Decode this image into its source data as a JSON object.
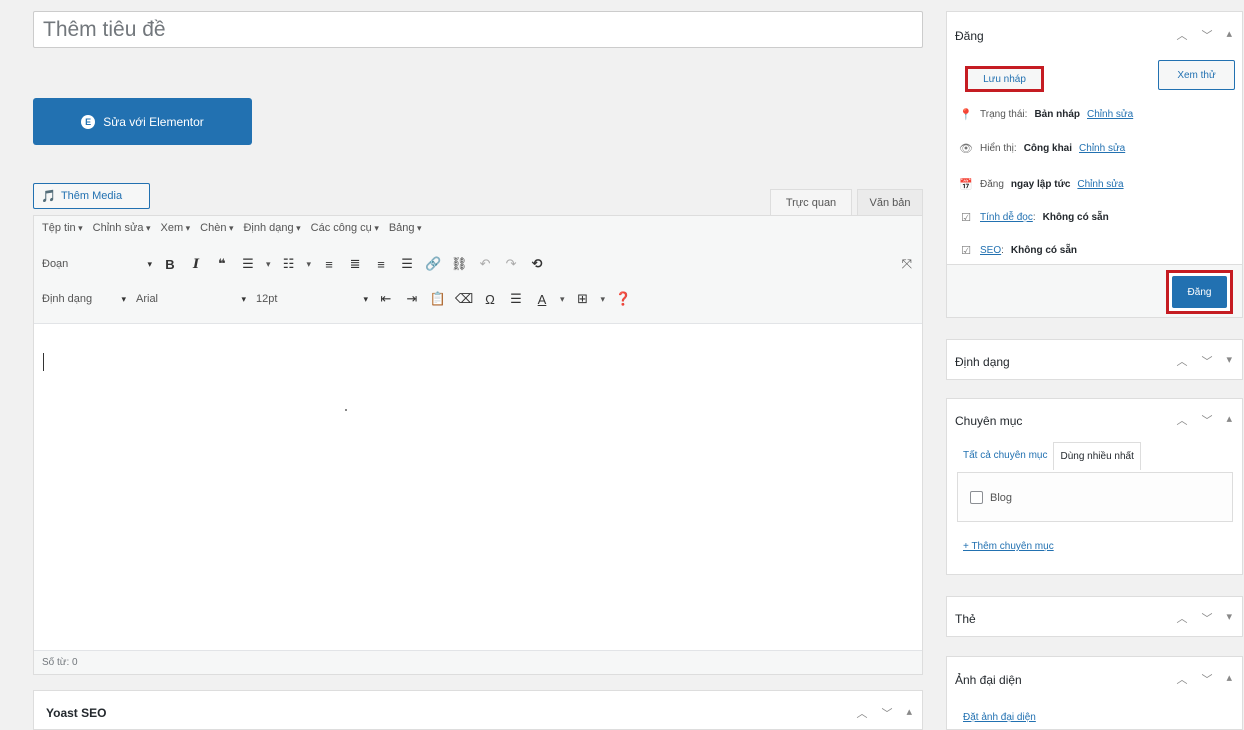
{
  "editor": {
    "title_placeholder": "Thêm tiêu đề",
    "elementor_button": "Sửa với Elementor",
    "add_media_button": "Thêm Media",
    "tabs": {
      "visual": "Trực quan",
      "text": "Văn bản"
    },
    "menubar": [
      "Tệp tin",
      "Chỉnh sửa",
      "Xem",
      "Chèn",
      "Định dạng",
      "Các công cụ",
      "Bảng"
    ],
    "toolbar": {
      "paragraph_select": "Đoạn",
      "format_menu": "Định dạng",
      "font_select": "Arial",
      "size_select": "12pt"
    },
    "word_count": "Số từ: 0"
  },
  "yoast": {
    "title": "Yoast SEO"
  },
  "sidebar": {
    "publish": {
      "title": "Đăng",
      "save_draft": "Lưu nháp",
      "preview": "Xem thử",
      "status_label": "Trạng thái:",
      "status_value": "Bản nháp",
      "visibility_label": "Hiển thị:",
      "visibility_value": "Công khai",
      "schedule_label": "Đăng",
      "schedule_value": "ngay lập tức",
      "edit_link": "Chỉnh sửa",
      "readability_link": "Tính dễ đọc",
      "readability_value": "Không có sẵn",
      "seo_link": "SEO",
      "seo_value": "Không có sẵn",
      "publish_button": "Đăng"
    },
    "format": {
      "title": "Định dạng"
    },
    "categories": {
      "title": "Chuyên mục",
      "tab_all": "Tất cả chuyên mục",
      "tab_most_used": "Dùng nhiều nhất",
      "items": [
        "Blog"
      ],
      "add_link": "+ Thêm chuyên mục"
    },
    "tags": {
      "title": "Thẻ"
    },
    "featured_image": {
      "title": "Ảnh đại diện",
      "set_link": "Đặt ảnh đại diện"
    }
  },
  "colors": {
    "accent": "#2271b1",
    "highlight": "#c51c22"
  }
}
